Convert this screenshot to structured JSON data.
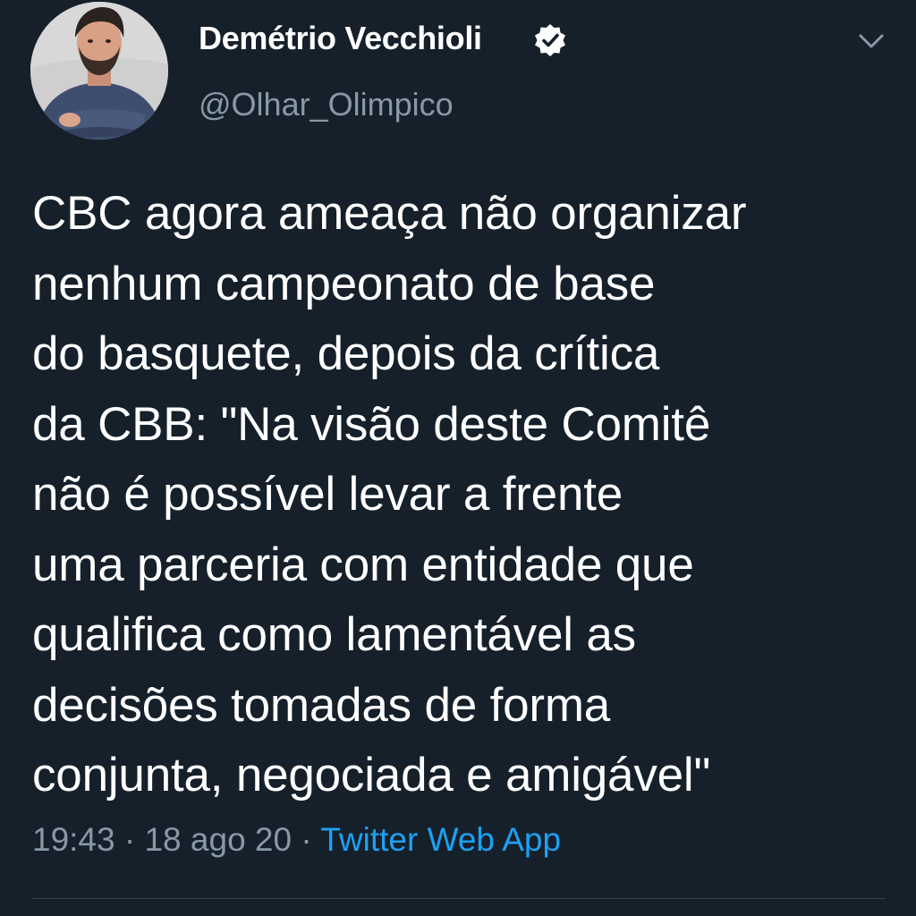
{
  "author": {
    "display_name": "Demétrio Vecchioli",
    "handle": "@Olhar_Olimpico",
    "verified": true,
    "avatar_icon": "profile-photo"
  },
  "tweet": {
    "lines": [
      "CBC agora ameaça não organizar",
      "nenhum campeonato de base",
      "do basquete, depois da crítica",
      "da CBB: \"Na visão deste Comitê",
      "não é possível levar a frente",
      "uma parceria com entidade que",
      "qualifica como lamentável as",
      "decisões tomadas de forma",
      "conjunta, negociada e amigável\""
    ]
  },
  "meta": {
    "time": "19:43",
    "separator": "·",
    "date": "18 ago 20",
    "source": "Twitter Web App"
  },
  "colors": {
    "background": "#15202b",
    "text_primary": "#ffffff",
    "text_secondary": "#8899a6",
    "link": "#1da1f2",
    "divider": "#38444d"
  }
}
